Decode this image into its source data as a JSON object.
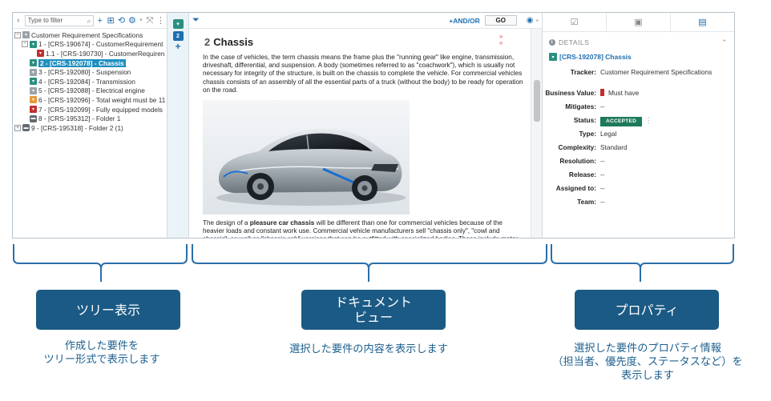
{
  "tree": {
    "filter_placeholder": "Type to filter",
    "collapse_icon": "chevron-left-icon",
    "items": [
      {
        "label": "Customer Requirement Specifications",
        "icon": "grey",
        "badge": "",
        "depth": 0,
        "expander": "−",
        "selected": false
      },
      {
        "label": "1 - [CRS-190674] - CustomerRequirement",
        "icon": "teal",
        "badge": "",
        "depth": 1,
        "expander": "−",
        "selected": false
      },
      {
        "label": "1.1 - [CRS-190730] - CustomerRequiren",
        "icon": "red",
        "badge": "",
        "depth": 2,
        "expander": "",
        "selected": false
      },
      {
        "label": "2 - [CRS-192078] - Chassis",
        "icon": "teal",
        "badge": "",
        "depth": 1,
        "expander": "",
        "selected": true
      },
      {
        "label": "3 - [CRS-192080] - Suspension",
        "icon": "grey",
        "badge": "",
        "depth": 1,
        "expander": "",
        "selected": false
      },
      {
        "label": "4 - [CRS-192084] - Transmission",
        "icon": "teal",
        "badge": "",
        "depth": 1,
        "expander": "",
        "selected": false
      },
      {
        "label": "5 - [CRS-192088] - Electrical engine",
        "icon": "grey",
        "badge": "",
        "depth": 1,
        "expander": "",
        "selected": false
      },
      {
        "label": "6 - [CRS-192096] - Total weight must be 11",
        "icon": "orange",
        "badge": "",
        "depth": 1,
        "expander": "",
        "selected": false
      },
      {
        "label": "7 - [CRS-192099] - Fully equipped models",
        "icon": "red",
        "badge": "",
        "depth": 1,
        "expander": "",
        "selected": false
      },
      {
        "label": "8 - [CRS-195312] - Folder 1",
        "icon": "folder",
        "badge": "",
        "depth": 1,
        "expander": "",
        "selected": false
      },
      {
        "label": "9 - [CRS-195318] - Folder 2 (1)",
        "icon": "folder",
        "badge": "",
        "depth": 0,
        "expander": "+",
        "selected": false
      }
    ]
  },
  "strip": {
    "badge": "2",
    "plus": "+"
  },
  "doc_toolbar": {
    "andor_label": "+AND/OR",
    "go_label": "GO"
  },
  "document": {
    "number": "2",
    "title": "Chassis",
    "marks_top": "»",
    "marks_bottom": "«",
    "paragraph1": "In the case of vehicles, the term chassis means the frame plus the \"running gear\" like engine, transmission, driveshaft, differential, and suspension. A body (sometimes referred to as \"coachwork\"), which is usually not necessary for integrity of the structure, is built on the chassis to complete the vehicle. For commercial vehicles chassis consists of an assembly of all the essential parts of a truck (without the body) to be ready for operation on the road.",
    "paragraph2_pre": "The design of a ",
    "paragraph2_bold": "pleasure car chassis",
    "paragraph2_post": " will be different than one for commercial vehicles because of the heavier loads and constant work use. Commercial vehicle manufacturers sell \"chassis only\", \"cowl and chassis\", as well as \"chassis cab\" versions that can be outfitted with specialized bodies. These include motor"
  },
  "properties": {
    "section_label": "DETAILS",
    "item_title": "[CRS-192078] Chassis",
    "rows": [
      {
        "label": "Tracker:",
        "value": "Customer Requirement Specifications"
      },
      {
        "label": "Business Value:",
        "value": "Must have"
      },
      {
        "label": "Mitigates:",
        "value": "--"
      },
      {
        "label": "Status:",
        "value": "ACCEPTED"
      },
      {
        "label": "Type:",
        "value": "Legal"
      },
      {
        "label": "Complexity:",
        "value": "Standard"
      },
      {
        "label": "Resolution:",
        "value": "--"
      },
      {
        "label": "Release:",
        "value": "--"
      },
      {
        "label": "Assigned to:",
        "value": "--"
      },
      {
        "label": "Team:",
        "value": "--"
      }
    ]
  },
  "callouts": {
    "tree_title": "ツリー表示",
    "tree_desc_1": "作成した要件を",
    "tree_desc_2": "ツリー形式で表示します",
    "doc_title_1": "ドキュメント",
    "doc_title_2": "ビュー",
    "doc_desc": "選択した要件の内容を表示します",
    "prop_title": "プロパティ",
    "prop_desc_1": "選択した要件のプロパティ情報",
    "prop_desc_2": "（担当者、優先度、ステータスなど）を",
    "prop_desc_3": "表示します"
  },
  "colors": {
    "accent": "#1f6fb0",
    "callout_bg": "#1b5a84",
    "callout_text": "#1c5f8f",
    "bracket": "#2b6ea8",
    "status_badge": "#1e7a5c",
    "selection": "#1f8fbf"
  }
}
